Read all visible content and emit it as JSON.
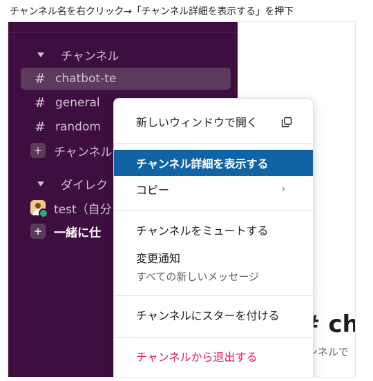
{
  "caption": "チャンネル名を右クリック→「チャンネル詳細を表示する」を押下",
  "sidebar": {
    "channels_header": "チャンネル",
    "channels": [
      {
        "label": "chatbot-te",
        "selected": true
      },
      {
        "label": "general"
      },
      {
        "label": "random"
      }
    ],
    "add_channel": "チャンネル",
    "dm_header": "ダイレク",
    "dms": [
      {
        "label": "test（自分"
      }
    ],
    "add_dm": "一緒に仕"
  },
  "main": {
    "title": "# cha",
    "subtitle": "ンネルで"
  },
  "context_menu": {
    "open_new_window": "新しいウィンドウで開く",
    "view_details": "チャンネル詳細を表示する",
    "copy": "コピー",
    "mute": "チャンネルをミュートする",
    "notifications": "変更通知",
    "notifications_value": "すべての新しいメッセージ",
    "star": "チャンネルにスターを付ける",
    "leave": "チャンネルから退出する"
  },
  "colors": {
    "sidebar_bg": "#3f0e40",
    "highlight": "#1164a3",
    "danger": "#e01e5a"
  }
}
